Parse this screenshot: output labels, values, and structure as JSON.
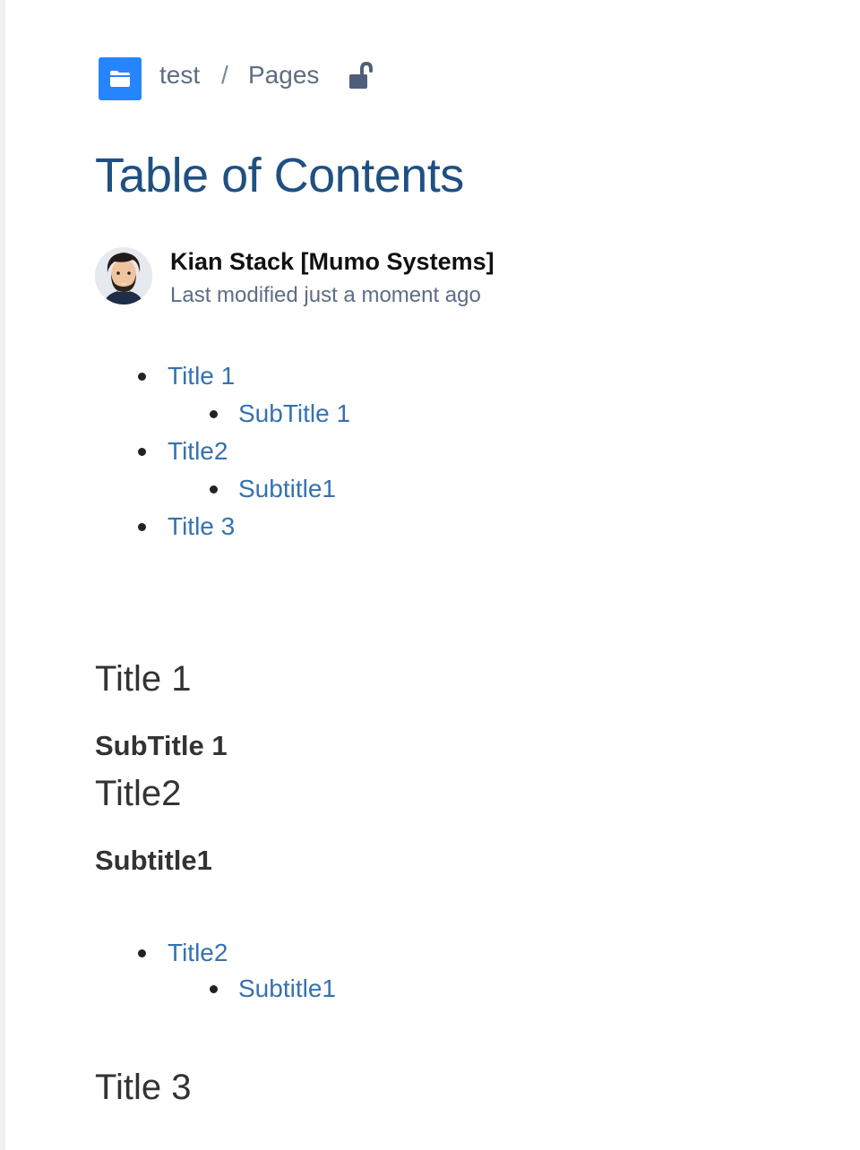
{
  "breadcrumb": {
    "space_icon": "folder-icon",
    "space": "test",
    "separator": "/",
    "section": "Pages",
    "lock_icon": "unlocked-padlock-icon"
  },
  "page": {
    "title": "Table of Contents"
  },
  "byline": {
    "author": "Kian Stack [Mumo Systems]",
    "modified": "Last modified just a moment ago"
  },
  "toc": [
    {
      "label": "Title 1",
      "children": [
        {
          "label": "SubTitle 1"
        }
      ]
    },
    {
      "label": "Title2",
      "children": [
        {
          "label": "Subtitle1"
        }
      ]
    },
    {
      "label": "Title 3",
      "children": []
    }
  ],
  "content": {
    "heading_title1": "Title 1",
    "heading_subtitle1a": "SubTitle 1",
    "heading_title2": "Title2",
    "heading_subtitle1b": "Subtitle1",
    "sub_toc": [
      {
        "label": "Title2",
        "children": [
          {
            "label": "Subtitle1"
          }
        ]
      }
    ],
    "heading_title3": "Title 3"
  },
  "colors": {
    "link": "#3572b0",
    "title": "#205081",
    "space_icon_bg": "#2684ff"
  }
}
